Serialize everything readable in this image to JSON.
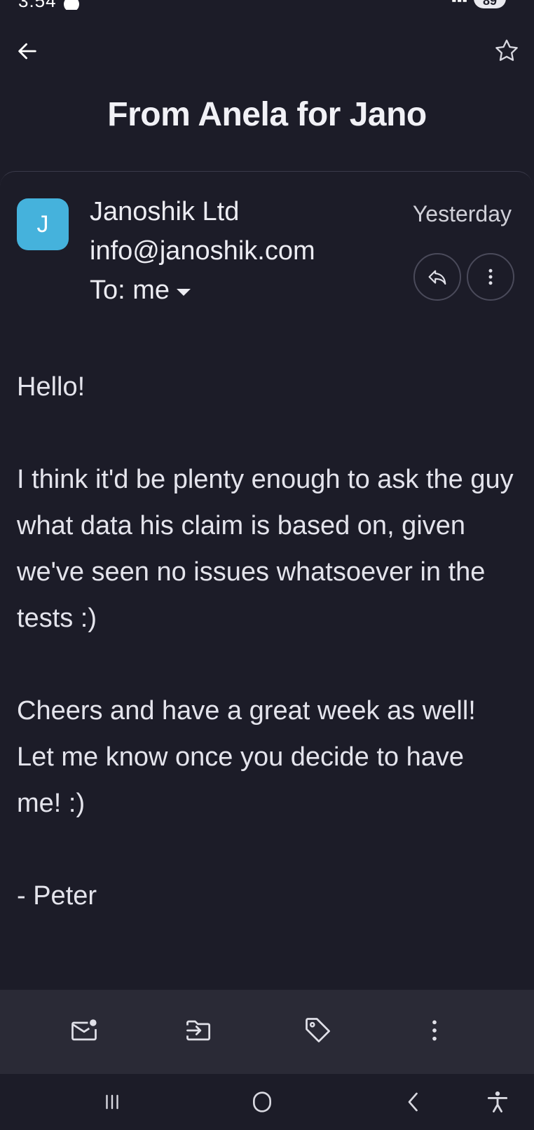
{
  "status_bar": {
    "time": "3:54",
    "battery": "89"
  },
  "app_bar": {
    "back_icon": "arrow-left-icon",
    "star_icon": "star-outline-icon"
  },
  "email": {
    "subject": "From Anela for Jano",
    "sender": {
      "initial": "J",
      "name": "Janoshik Ltd",
      "address": "info@janoshik.com",
      "avatar_color": "#45b2dc"
    },
    "recipient_label": "To: me",
    "date": "Yesterday",
    "body": {
      "greeting": "Hello!",
      "paragraph1": "I think it'd be plenty enough to ask the guy what data his claim is based on, given we've seen no issues whatsoever in the tests :)",
      "paragraph2": "Cheers and have a great week as well! Let me know once you decide to have me! :)",
      "signature": "- Peter"
    }
  },
  "actions": [
    {
      "name": "mark-unread",
      "icon": "mail-unread-icon"
    },
    {
      "name": "move-to",
      "icon": "move-to-icon"
    },
    {
      "name": "label",
      "icon": "tag-icon"
    },
    {
      "name": "more",
      "icon": "more-vertical-icon"
    }
  ],
  "colors": {
    "background": "#1c1c28",
    "action_bar": "#2a2a36",
    "text": "#e4e4ec",
    "avatar": "#45b2dc"
  }
}
